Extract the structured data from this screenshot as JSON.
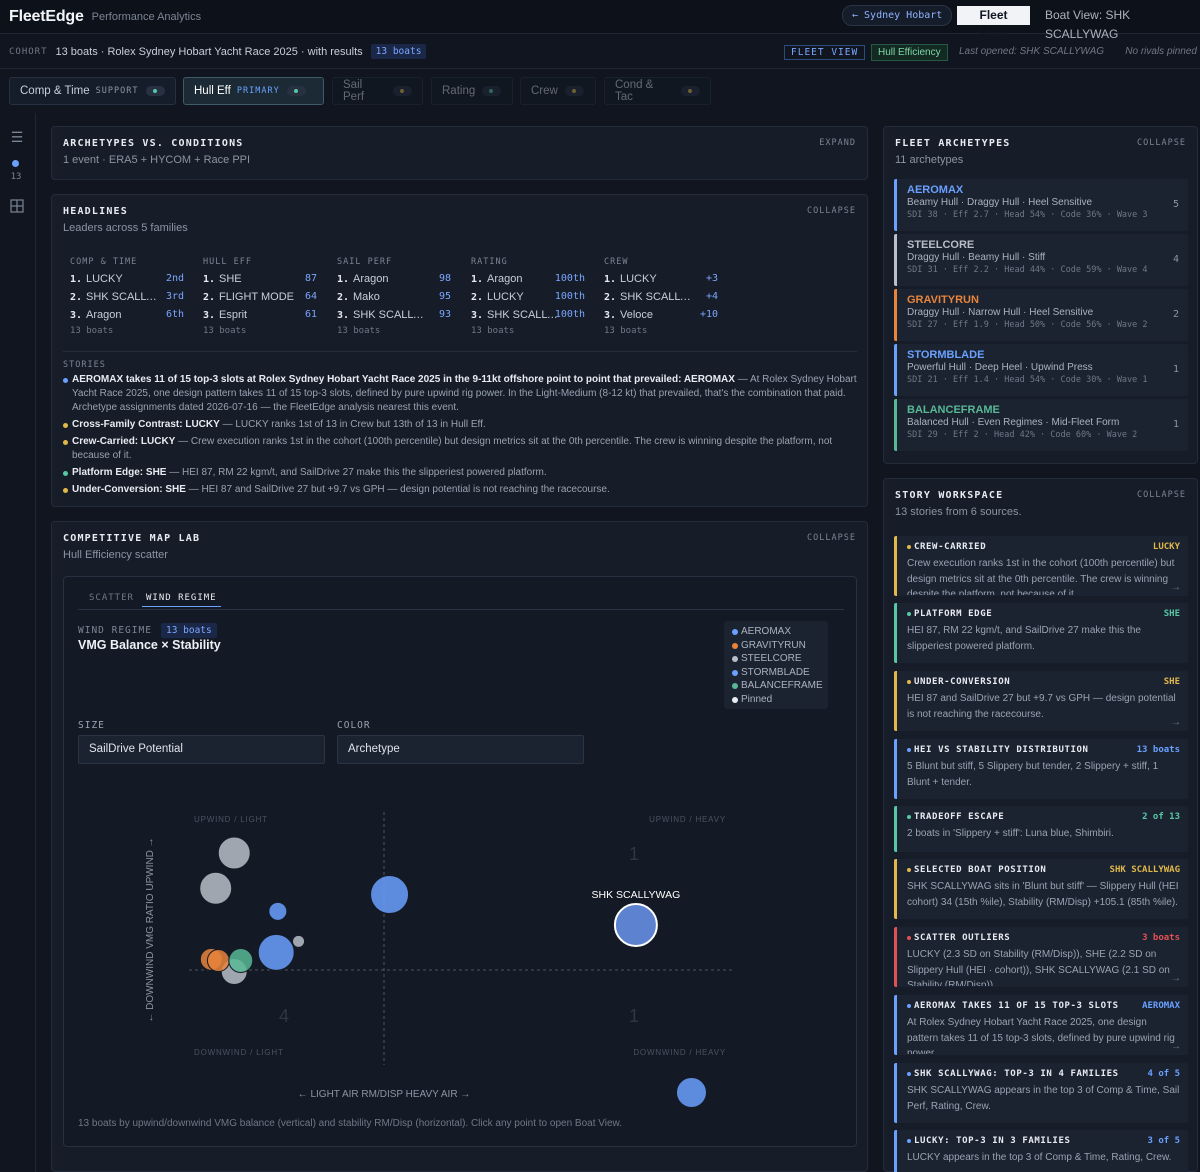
{
  "topbar": {
    "brand": "FleetEdge",
    "subtitle": "Performance Analytics",
    "race_chip": "← Sydney Hobart",
    "tab_fleet": "Fleet View",
    "tab_boat": "Boat View: SHK SCALLYWAG"
  },
  "cohort": {
    "label": "COHORT",
    "text": "13 boats · Rolex Sydney Hobart Yacht Race 2025 · with results",
    "count_tag": "13 boats",
    "fleet_view": "FLEET VIEW",
    "hull_eff": "Hull Efficiency",
    "last_opened": "Last opened: SHK SCALLYWAG",
    "rivals": "No rivals pinned"
  },
  "family_tabs": [
    {
      "label": "Comp & Time",
      "role": "SUPPORT",
      "role_color": "#8c95a4",
      "state": "normal"
    },
    {
      "label": "Hull Eff",
      "role": "PRIMARY",
      "role_color": "#6aa0ff",
      "state": "active"
    },
    {
      "label": "Sail Perf",
      "role": "",
      "state": "dim",
      "dot": "#e2b84a"
    },
    {
      "label": "Rating",
      "role": "",
      "state": "dim",
      "dot": "#58c7a6"
    },
    {
      "label": "Crew",
      "role": "",
      "state": "dim",
      "dot": "#e2b84a"
    },
    {
      "label": "Cond & Tac",
      "role": "",
      "state": "dim",
      "dot": "#e2b84a"
    }
  ],
  "rail": {
    "count": "13"
  },
  "arch_conditions": {
    "title": "ARCHETYPES VS. CONDITIONS",
    "sub": "1 event · ERA5 + HYCOM + Race PPI",
    "action": "EXPAND"
  },
  "headlines": {
    "title": "HEADLINES",
    "sub": "Leaders across 5 families",
    "action": "COLLAPSE",
    "columns": [
      {
        "head": "COMP & TIME",
        "rows": [
          {
            "rank": "1.",
            "name": "LUCKY",
            "val": "2nd"
          },
          {
            "rank": "2.",
            "name": "SHK SCALLYWAG",
            "val": "3rd"
          },
          {
            "rank": "3.",
            "name": "Aragon",
            "val": "6th"
          }
        ],
        "foot": "13 boats"
      },
      {
        "head": "HULL EFF",
        "rows": [
          {
            "rank": "1.",
            "name": "SHE",
            "val": "87"
          },
          {
            "rank": "2.",
            "name": "FLIGHT MODE",
            "val": "64"
          },
          {
            "rank": "3.",
            "name": "Esprit",
            "val": "61"
          }
        ],
        "foot": "13 boats"
      },
      {
        "head": "SAIL PERF",
        "rows": [
          {
            "rank": "1.",
            "name": "Aragon",
            "val": "98"
          },
          {
            "rank": "2.",
            "name": "Mako",
            "val": "95"
          },
          {
            "rank": "3.",
            "name": "SHK SCALLYWAG",
            "val": "93"
          }
        ],
        "foot": "13 boats"
      },
      {
        "head": "RATING",
        "rows": [
          {
            "rank": "1.",
            "name": "Aragon",
            "val": "100th"
          },
          {
            "rank": "2.",
            "name": "LUCKY",
            "val": "100th"
          },
          {
            "rank": "3.",
            "name": "SHK SCALLYWAG",
            "val": "100th"
          }
        ],
        "foot": "13 boats"
      },
      {
        "head": "CREW",
        "rows": [
          {
            "rank": "1.",
            "name": "LUCKY",
            "val": "+3"
          },
          {
            "rank": "2.",
            "name": "SHK SCALLYWAG",
            "val": "+4"
          },
          {
            "rank": "3.",
            "name": "Veloce",
            "val": "+10"
          }
        ],
        "foot": "13 boats"
      }
    ],
    "stories_head": "STORIES",
    "stories": [
      {
        "color": "#6aa0ff",
        "lead": "AEROMAX takes 11 of 15 top-3 slots at Rolex Sydney Hobart Yacht Race 2025 in the 9-11kt offshore point to point that prevailed: AEROMAX",
        "text": " — At Rolex Sydney Hobart Yacht Race 2025, one design pattern takes 11 of 15 top-3 slots, defined by pure upwind rig power. In the Light-Medium (8-12 kt) that prevailed, that's the combination that paid. Archetype assignments dated 2026-07-16 — the FleetEdge analysis nearest this event."
      },
      {
        "color": "#e2b84a",
        "lead": "Cross-Family Contrast: LUCKY",
        "text": " — LUCKY ranks 1st of 13 in Crew but 13th of 13 in Hull Eff."
      },
      {
        "color": "#e2b84a",
        "lead": "Crew-Carried: LUCKY",
        "text": " — Crew execution ranks 1st in the cohort (100th percentile) but design metrics sit at the 0th percentile. The crew is winning despite the platform, not because of it."
      },
      {
        "color": "#58c7a6",
        "lead": "Platform Edge: SHE",
        "text": " — HEI 87, RM 22 kgm/t, and SailDrive 27 make this the slipperiest powered platform."
      },
      {
        "color": "#e2b84a",
        "lead": "Under-Conversion: SHE",
        "text": " — HEI 87 and SailDrive 27 but +9.7 vs GPH — design potential is not reaching the racecourse."
      }
    ]
  },
  "maplab": {
    "title": "COMPETITIVE MAP LAB",
    "sub": "Hull Efficiency scatter",
    "action": "COLLAPSE",
    "tab_scatter": "SCATTER",
    "tab_wind": "WIND REGIME",
    "regime_label": "WIND REGIME",
    "regime_count": "13 boats",
    "chart_title": "VMG Balance × Stability",
    "size_label": "SIZE",
    "size_value": "SailDrive Potential",
    "color_label": "COLOR",
    "color_value": "Archetype",
    "legend": [
      {
        "name": "AEROMAX",
        "color": "#6aa0ff"
      },
      {
        "name": "GRAVITYRUN",
        "color": "#e8843c"
      },
      {
        "name": "STEELCORE",
        "color": "#b9bfc9"
      },
      {
        "name": "STORMBLADE",
        "color": "#6aa0ff"
      },
      {
        "name": "BALANCEFRAME",
        "color": "#58b896"
      },
      {
        "name": "Pinned",
        "color": "#e8ecf2"
      }
    ],
    "caption": "13 boats by upwind/downwind VMG balance (vertical) and stability RM/Disp (horizontal). Click any point to open Boat View."
  },
  "chart_data": {
    "type": "scatter",
    "title": "VMG Balance × Stability",
    "xlabel": "← LIGHT AIR RM/DISP HEAVY AIR →",
    "ylabel": "← DOWNWIND VMG RATIO UPWIND →",
    "xlim": [
      0,
      1
    ],
    "ylim": [
      0,
      1
    ],
    "quadrants": [
      {
        "label": "UPWIND / LIGHT",
        "count": ""
      },
      {
        "label": "UPWIND / HEAVY",
        "count": "1"
      },
      {
        "label": "DOWNWIND / LIGHT",
        "count": "4"
      },
      {
        "label": "DOWNWIND / HEAVY",
        "count": "1"
      }
    ],
    "points": [
      {
        "x": 0.083,
        "y": 0.85,
        "r": 16,
        "archetype": "STEELCORE",
        "color": "#b9bfc9",
        "label": ""
      },
      {
        "x": 0.049,
        "y": 0.703,
        "r": 16,
        "archetype": "STEELCORE",
        "color": "#b9bfc9",
        "label": ""
      },
      {
        "x": 0.163,
        "y": 0.607,
        "r": 9,
        "archetype": "AEROMAX",
        "color": "#6aa0ff",
        "label": ""
      },
      {
        "x": 0.368,
        "y": 0.677,
        "r": 19,
        "archetype": "AEROMAX",
        "color": "#6aa0ff",
        "label": ""
      },
      {
        "x": 0.201,
        "y": 0.482,
        "r": 6,
        "archetype": "STEELCORE",
        "color": "#b9bfc9",
        "label": ""
      },
      {
        "x": 0.16,
        "y": 0.436,
        "r": 18,
        "archetype": "AEROMAX",
        "color": "#6aa0ff",
        "label": ""
      },
      {
        "x": 0.083,
        "y": 0.356,
        "r": 13,
        "archetype": "STEELCORE",
        "color": "#b9bfc9",
        "label": ""
      },
      {
        "x": 0.041,
        "y": 0.407,
        "r": 11,
        "archetype": "GRAVITYRUN",
        "color": "#e8843c",
        "label": ""
      },
      {
        "x": 0.054,
        "y": 0.402,
        "r": 11,
        "archetype": "GRAVITYRUN",
        "color": "#e8843c",
        "label": ""
      },
      {
        "x": 0.095,
        "y": 0.402,
        "r": 12,
        "archetype": "BALANCEFRAME",
        "color": "#58b896",
        "label": ""
      },
      {
        "x": 0.82,
        "y": 0.55,
        "r": 21,
        "archetype": "AEROMAX",
        "color": "#6a96ee",
        "label": "SHK SCALLYWAG"
      },
      {
        "x": 0.922,
        "y": -0.148,
        "r": 15,
        "archetype": "AEROMAX",
        "color": "#6aa0ff",
        "label": ""
      }
    ]
  },
  "fleet_archetypes": {
    "title": "FLEET ARCHETYPES",
    "sub": "11 archetypes",
    "action": "COLLAPSE",
    "items": [
      {
        "name": "AEROMAX",
        "color": "#6aa0ff",
        "desc": "Beamy Hull · Draggy Hull · Heel Sensitive",
        "stats": "SDI 38 · Eff 2.7 · Head 54% · Code 36% · Wave 3",
        "count": "5"
      },
      {
        "name": "STEELCORE",
        "color": "#b9bfc9",
        "desc": "Draggy Hull · Beamy Hull · Stiff",
        "stats": "SDI 31 · Eff 2.2 · Head 44% · Code 59% · Wave 4",
        "count": "4"
      },
      {
        "name": "GRAVITYRUN",
        "color": "#e8843c",
        "desc": "Draggy Hull · Narrow Hull · Heel Sensitive",
        "stats": "SDI 27 · Eff 1.9 · Head 50% · Code 56% · Wave 2",
        "count": "2"
      },
      {
        "name": "STORMBLADE",
        "color": "#6aa0ff",
        "desc": "Powerful Hull · Deep Heel · Upwind Press",
        "stats": "SDI 21 · Eff 1.4 · Head 54% · Code 30% · Wave 1",
        "count": "1"
      },
      {
        "name": "BALANCEFRAME",
        "color": "#58b896",
        "desc": "Balanced Hull · Even Regimes · Mid-Fleet Form",
        "stats": "SDI 29 · Eff 2 · Head 42% · Code 60% · Wave 2",
        "count": "1"
      }
    ]
  },
  "workspace": {
    "title": "STORY WORKSPACE",
    "sub": "13 stories from 6 sources.",
    "action": "COLLAPSE",
    "cards": [
      {
        "title": "CREW-CARRIED",
        "badge": "LUCKY",
        "color": "#e2b84a",
        "badge_color": "#e2b84a",
        "text": "Crew execution ranks 1st in the cohort (100th percentile) but design metrics sit at the 0th percentile. The crew is winning despite the platform, not because of it.",
        "arrow": "→"
      },
      {
        "title": "PLATFORM EDGE",
        "badge": "SHE",
        "color": "#58c7a6",
        "badge_color": "#58c7a6",
        "text": "HEI 87, RM 22 kgm/t, and SailDrive 27 make this the slipperiest powered platform.",
        "arrow": ""
      },
      {
        "title": "UNDER-CONVERSION",
        "badge": "SHE",
        "color": "#e2b84a",
        "badge_color": "#e2b84a",
        "text": "HEI 87 and SailDrive 27 but +9.7 vs GPH — design potential is not reaching the racecourse.",
        "arrow": "→"
      },
      {
        "title": "HEI VS STABILITY DISTRIBUTION",
        "badge": "13 boats",
        "color": "#6aa0ff",
        "badge_color": "#6aa0ff",
        "text": "5 Blunt but stiff, 5 Slippery but tender, 2 Slippery + stiff, 1 Blunt + tender.",
        "arrow": ""
      },
      {
        "title": "TRADEOFF ESCAPE",
        "badge": "2 of 13",
        "color": "#58c7a6",
        "badge_color": "#58c7a6",
        "text": "2 boats in 'Slippery + stiff': Luna blue, Shimbiri.",
        "arrow": ""
      },
      {
        "title": "SELECTED BOAT POSITION",
        "badge": "SHK SCALLYWAG",
        "color": "#e2b84a",
        "badge_color": "#e2b84a",
        "text": "SHK SCALLYWAG sits in 'Blunt but stiff' — Slippery Hull (HEI cohort) 34 (15th %ile), Stability (RM/Disp) +105.1 (85th %ile).",
        "arrow": ""
      },
      {
        "title": "SCATTER OUTLIERS",
        "badge": "3 boats",
        "color": "#e05252",
        "badge_color": "#e05252",
        "text": "LUCKY (2.3 SD on Stability (RM/Disp)), SHE (2.2 SD on Slippery Hull (HEI · cohort)), SHK SCALLYWAG (2.1 SD on Stability (RM/Disp)).",
        "arrow": "→"
      },
      {
        "title": "AEROMAX TAKES 11 OF 15 TOP-3 SLOTS …",
        "badge": "AEROMAX",
        "color": "#6aa0ff",
        "badge_color": "#6aa0ff",
        "text": "At Rolex Sydney Hobart Yacht Race 2025, one design pattern takes 11 of 15 top-3 slots, defined by pure upwind rig power.",
        "arrow": "→"
      },
      {
        "title": "SHK SCALLYWAG: TOP-3 IN 4 FAMILIES",
        "badge": "4 of 5",
        "color": "#6aa0ff",
        "badge_color": "#6aa0ff",
        "text": "SHK SCALLYWAG appears in the top 3 of Comp & Time, Sail Perf, Rating, Crew.",
        "arrow": ""
      },
      {
        "title": "LUCKY: TOP-3 IN 3 FAMILIES",
        "badge": "3 of 5",
        "color": "#6aa0ff",
        "badge_color": "#6aa0ff",
        "text": "LUCKY appears in the top 3 of Comp & Time, Rating, Crew.",
        "arrow": ""
      }
    ]
  }
}
